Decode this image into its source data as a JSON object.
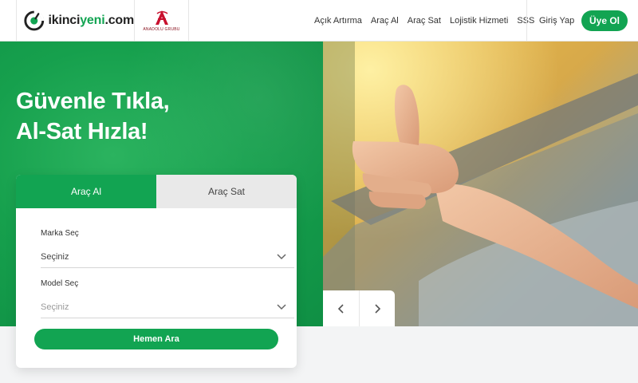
{
  "brand": {
    "name_prefix": "ikinci",
    "name_highlight": "yeni",
    "name_suffix": ".com",
    "partner_name": "ANADOLU GRUBU",
    "accent_color": "#12a452"
  },
  "nav": {
    "items": [
      {
        "label": "Açık Artırma"
      },
      {
        "label": "Araç Al"
      },
      {
        "label": "Araç Sat"
      },
      {
        "label": "Lojistik Hizmeti"
      },
      {
        "label": "SSS"
      }
    ],
    "login_label": "Giriş Yap",
    "signup_label": "Üye Ol"
  },
  "hero": {
    "title_line1": "Güvenle Tıkla,",
    "title_line2": "Al-Sat Hızla!",
    "prev_icon": "chevron-left-icon",
    "next_icon": "chevron-right-icon"
  },
  "search_card": {
    "tabs": [
      {
        "label": "Araç Al",
        "active": true
      },
      {
        "label": "Araç Sat",
        "active": false
      }
    ],
    "brand_field": {
      "label": "Marka Seç",
      "value": "Seçiniz"
    },
    "model_field": {
      "label": "Model Seç",
      "value": "Seçiniz"
    },
    "submit_label": "Hemen Ara"
  }
}
